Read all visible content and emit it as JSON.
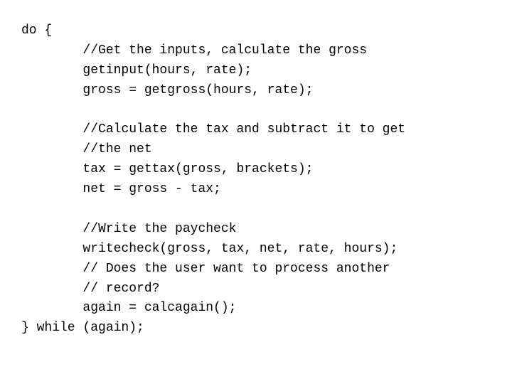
{
  "code": {
    "lines": [
      "do {",
      "        //Get the inputs, calculate the gross",
      "        getinput(hours, rate);",
      "        gross = getgross(hours, rate);",
      "",
      "        //Calculate the tax and subtract it to get",
      "        //the net",
      "        tax = gettax(gross, brackets);",
      "        net = gross - tax;",
      "",
      "        //Write the paycheck",
      "        writecheck(gross, tax, net, rate, hours);",
      "        // Does the user want to process another",
      "        // record?",
      "        again = calcagain();",
      "} while (again);"
    ]
  }
}
